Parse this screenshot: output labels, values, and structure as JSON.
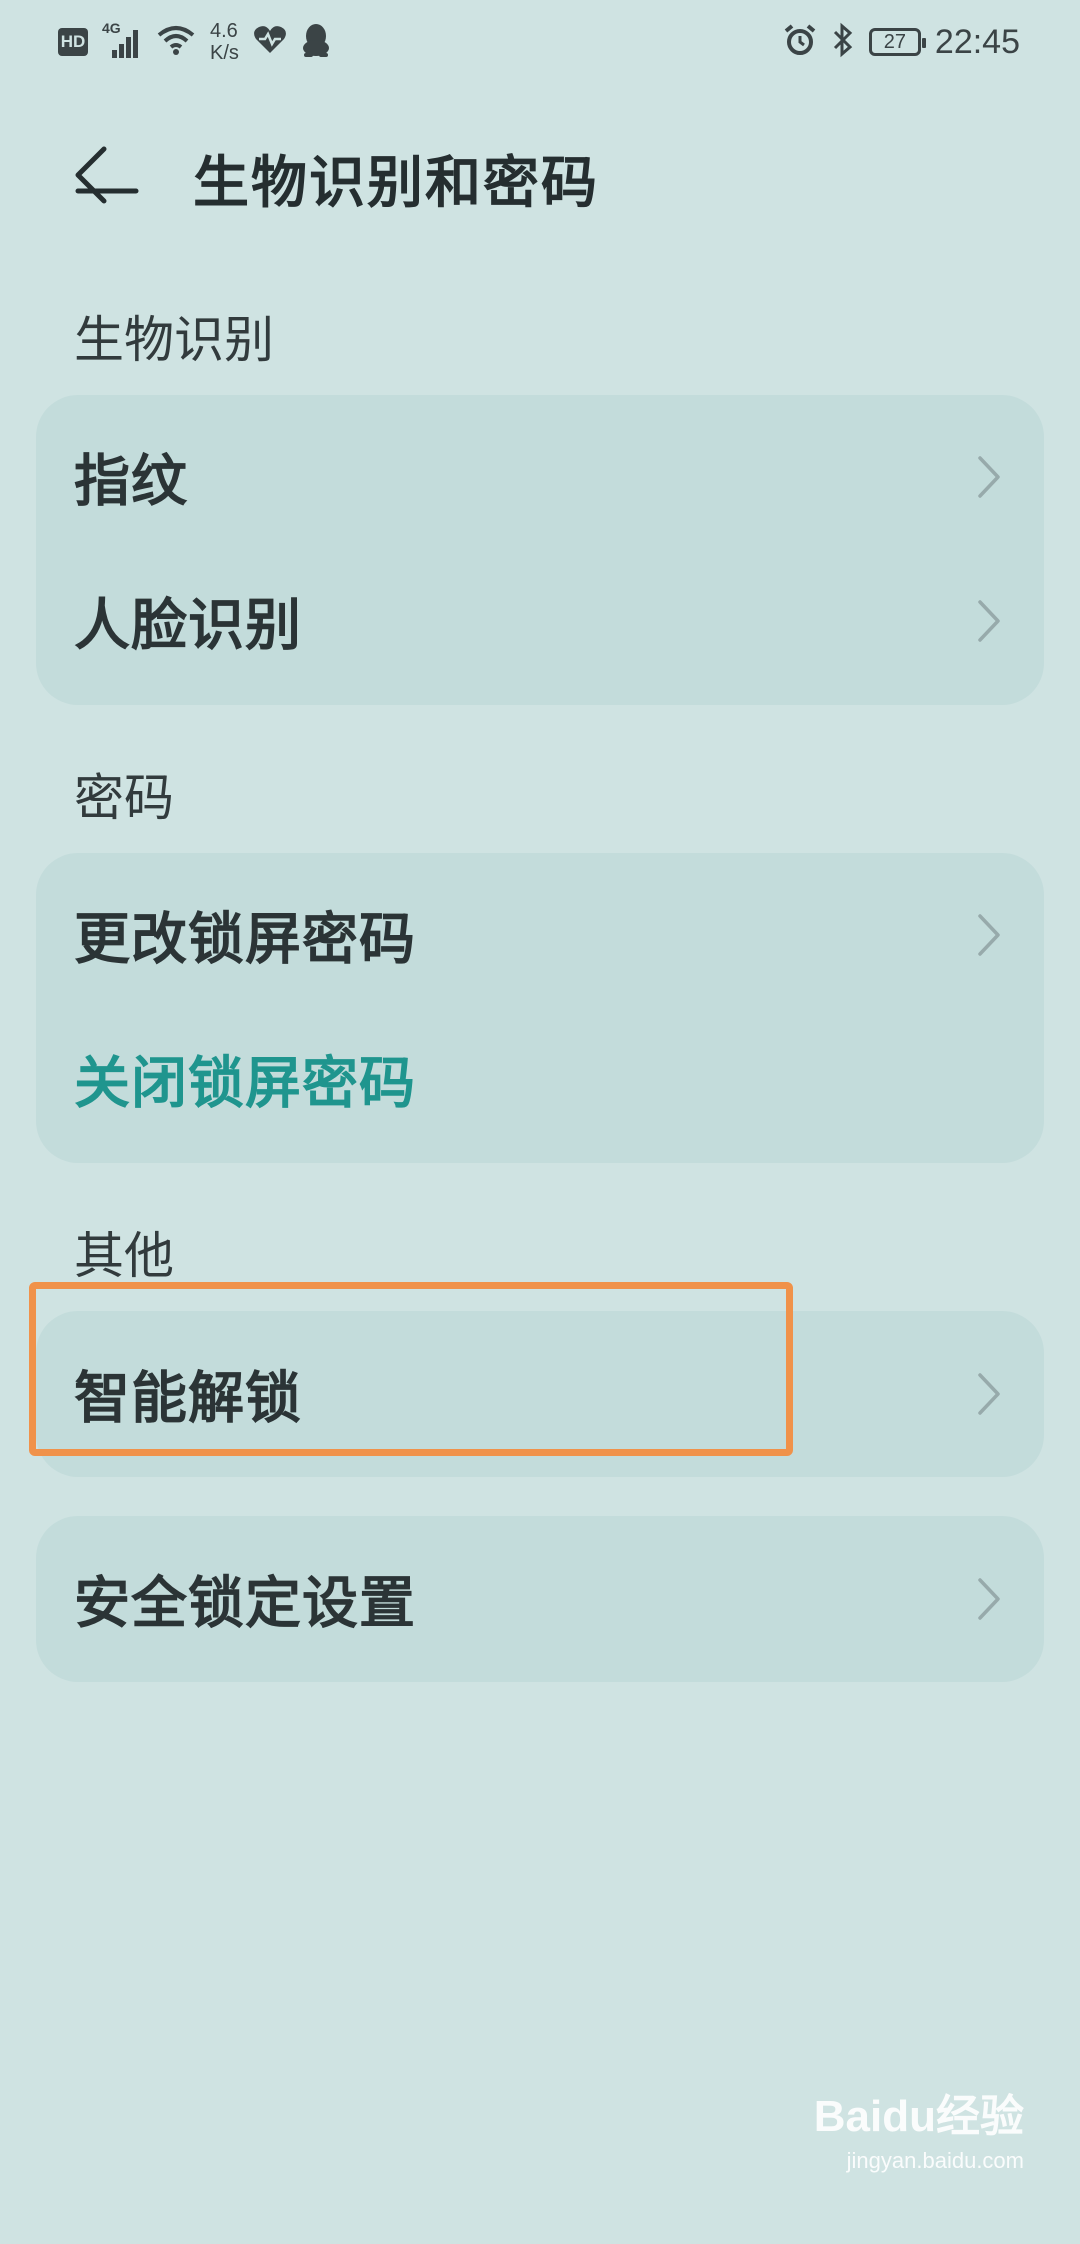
{
  "status_bar": {
    "hd_label": "HD",
    "network_type": "4G",
    "net_speed_value": "4.6",
    "net_speed_unit": "K/s",
    "battery_level": "27",
    "time": "22:45",
    "icons": [
      "hd-icon",
      "signal-icon",
      "wifi-icon",
      "heart-rate-icon",
      "qq-penguin-icon",
      "alarm-icon",
      "bluetooth-icon",
      "battery-icon"
    ]
  },
  "header": {
    "title": "生物识别和密码",
    "back_icon": "back-arrow-icon"
  },
  "sections": [
    {
      "label": "生物识别",
      "items": [
        {
          "label": "指纹",
          "chevron": true
        },
        {
          "label": "人脸识别",
          "chevron": true
        }
      ]
    },
    {
      "label": "密码",
      "items": [
        {
          "label": "更改锁屏密码",
          "chevron": true
        },
        {
          "label": "关闭锁屏密码",
          "chevron": false,
          "accent": true
        }
      ]
    },
    {
      "label": "其他",
      "items": [
        {
          "label": "智能解锁",
          "chevron": true
        }
      ]
    },
    {
      "label": "",
      "items": [
        {
          "label": "安全锁定设置",
          "chevron": true
        }
      ]
    }
  ],
  "watermark": {
    "brand": "Baidu经验",
    "url": "jingyan.baidu.com"
  },
  "colors": {
    "background": "#cfe3e2",
    "card": "#c3dcdb",
    "accent": "#1f958e",
    "highlight": "#f0924a"
  }
}
